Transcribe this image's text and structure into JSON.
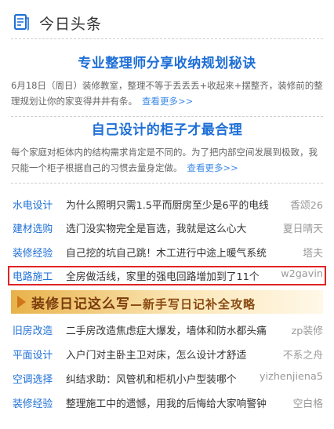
{
  "header": {
    "title": "今日头条"
  },
  "features": [
    {
      "title": "专业整理师分享收纳规划秘诀",
      "desc": "6月18日（周日）装修教室，整理不等于丢丢丢+收起来+摆整齐，装修前的整理规划让你的家变得井井有条。",
      "more": "查看更多>>"
    },
    {
      "title": "自己设计的柜子才最合理",
      "desc": "每个家庭对柜体内的结构需求肯定是不同的。为了把内部空间发展到极致，我只能一个柜子根据自己的习惯去量身定做。",
      "more": "查看更多>>"
    }
  ],
  "list1": [
    {
      "cat": "水电设计",
      "text": "为什么照明只需1.5平而厨房至少是6平的电线",
      "author": "香颂26"
    },
    {
      "cat": "建材选购",
      "text": "选门没实物完全是盲选，我就是这么心大",
      "author": "夏日晴天"
    },
    {
      "cat": "装修经验",
      "text": "自己挖的坑自己跳！木工进行中途上暖气系统",
      "author": "塔夫"
    },
    {
      "cat": "电路施工",
      "text": "全房做活线，家里的强电回路增加到了11个",
      "author": "w2gavin"
    }
  ],
  "banner": {
    "main": "装修日记这么写",
    "sub": "—新手写日记补全攻略"
  },
  "list2": [
    {
      "cat": "旧房改造",
      "text": "二手房改造焦虑症大爆发，墙体和防水都头痛",
      "author": "zp装修"
    },
    {
      "cat": "平面设计",
      "text": "入户门对主卧主卫对床，怎么设计才舒适",
      "author": "不系之舟"
    },
    {
      "cat": "空调选择",
      "text": "纠结求助：风管机和柜机小户型装哪个",
      "author": "yizhenjiena5"
    },
    {
      "cat": "装修经验",
      "text": "整理施工中的遗憾，用我的后悔给大家响警钟",
      "author": "空白格"
    }
  ],
  "colors": {
    "accent": "#1e6fd6",
    "highlight": "#e02424",
    "banner": "#e8b24a"
  }
}
